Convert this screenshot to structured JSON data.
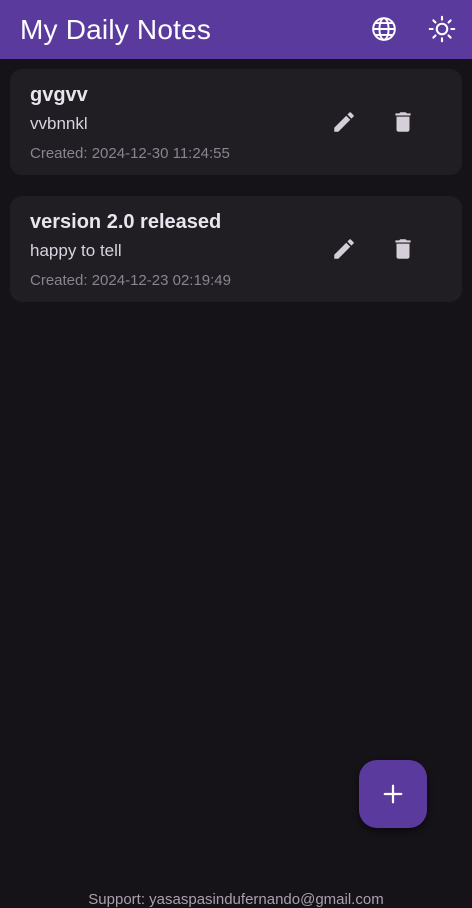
{
  "app_bar": {
    "title": "My Daily Notes",
    "actions": [
      {
        "icon": "globe-icon"
      },
      {
        "icon": "sun-icon"
      }
    ]
  },
  "notes": [
    {
      "title": "gvgvv",
      "body": "vvbnnkl",
      "created": "Created: 2024-12-30 11:24:55",
      "actions": [
        "edit-icon",
        "delete-icon"
      ]
    },
    {
      "title": "version 2.0 released",
      "body": "happy to tell",
      "created": "Created: 2024-12-23 02:19:49",
      "actions": [
        "edit-icon",
        "delete-icon"
      ]
    }
  ],
  "fab": {
    "icon": "plus-icon"
  },
  "footer": {
    "support": "Support: yasaspasindufernando@gmail.com"
  },
  "colors": {
    "app_bar": "#5b3a9e",
    "background": "#151218",
    "card": "#201d23",
    "fab": "#5b3a9e"
  }
}
